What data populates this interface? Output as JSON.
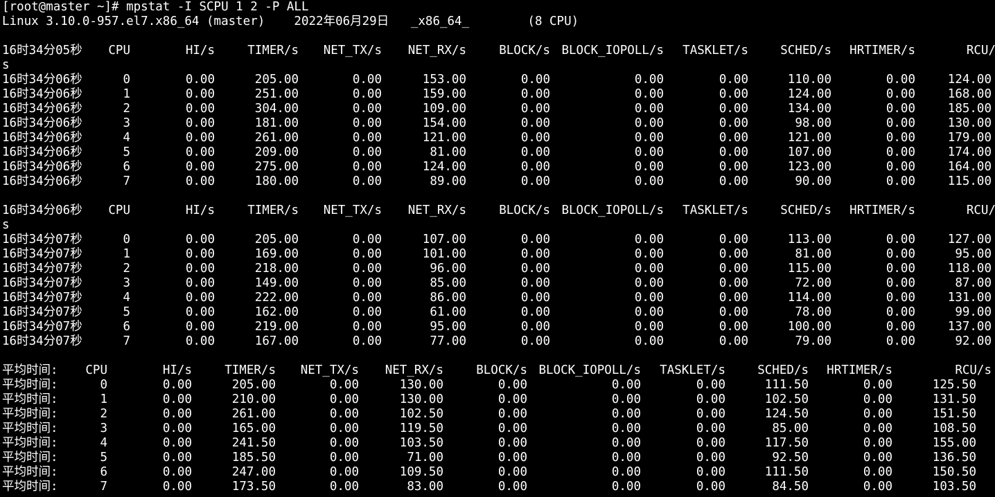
{
  "terminal": {
    "prompt": "[root@master ~]# mpstat -I SCPU 1 2 -P ALL",
    "sysinfo": "Linux 3.10.0-957.el7.x86_64 (master)    2022年06月29日   _x86_64_        (8 CPU)"
  },
  "headers": [
    "CPU",
    "HI/s",
    "TIMER/s",
    "NET_TX/s",
    "NET_RX/s",
    "BLOCK/s",
    "BLOCK_IOPOLL/s",
    "TASKLET/s",
    "SCHED/s",
    "HRTIMER/s",
    "RCU/s"
  ],
  "blocks": [
    {
      "time": "16时34分05秒",
      "rows": [
        {
          "time": "16时34分06秒",
          "cells": [
            "0",
            "0.00",
            "205.00",
            "0.00",
            "153.00",
            "0.00",
            "0.00",
            "0.00",
            "110.00",
            "0.00",
            "124.00"
          ]
        },
        {
          "time": "16时34分06秒",
          "cells": [
            "1",
            "0.00",
            "251.00",
            "0.00",
            "159.00",
            "0.00",
            "0.00",
            "0.00",
            "124.00",
            "0.00",
            "168.00"
          ]
        },
        {
          "time": "16时34分06秒",
          "cells": [
            "2",
            "0.00",
            "304.00",
            "0.00",
            "109.00",
            "0.00",
            "0.00",
            "0.00",
            "134.00",
            "0.00",
            "185.00"
          ]
        },
        {
          "time": "16时34分06秒",
          "cells": [
            "3",
            "0.00",
            "181.00",
            "0.00",
            "154.00",
            "0.00",
            "0.00",
            "0.00",
            "98.00",
            "0.00",
            "130.00"
          ]
        },
        {
          "time": "16时34分06秒",
          "cells": [
            "4",
            "0.00",
            "261.00",
            "0.00",
            "121.00",
            "0.00",
            "0.00",
            "0.00",
            "121.00",
            "0.00",
            "179.00"
          ]
        },
        {
          "time": "16时34分06秒",
          "cells": [
            "5",
            "0.00",
            "209.00",
            "0.00",
            "81.00",
            "0.00",
            "0.00",
            "0.00",
            "107.00",
            "0.00",
            "174.00"
          ]
        },
        {
          "time": "16时34分06秒",
          "cells": [
            "6",
            "0.00",
            "275.00",
            "0.00",
            "124.00",
            "0.00",
            "0.00",
            "0.00",
            "123.00",
            "0.00",
            "164.00"
          ]
        },
        {
          "time": "16时34分06秒",
          "cells": [
            "7",
            "0.00",
            "180.00",
            "0.00",
            "89.00",
            "0.00",
            "0.00",
            "0.00",
            "90.00",
            "0.00",
            "115.00"
          ]
        }
      ]
    },
    {
      "time": "16时34分06秒",
      "rows": [
        {
          "time": "16时34分07秒",
          "cells": [
            "0",
            "0.00",
            "205.00",
            "0.00",
            "107.00",
            "0.00",
            "0.00",
            "0.00",
            "113.00",
            "0.00",
            "127.00"
          ]
        },
        {
          "time": "16时34分07秒",
          "cells": [
            "1",
            "0.00",
            "169.00",
            "0.00",
            "101.00",
            "0.00",
            "0.00",
            "0.00",
            "81.00",
            "0.00",
            "95.00"
          ]
        },
        {
          "time": "16时34分07秒",
          "cells": [
            "2",
            "0.00",
            "218.00",
            "0.00",
            "96.00",
            "0.00",
            "0.00",
            "0.00",
            "115.00",
            "0.00",
            "118.00"
          ]
        },
        {
          "time": "16时34分07秒",
          "cells": [
            "3",
            "0.00",
            "149.00",
            "0.00",
            "85.00",
            "0.00",
            "0.00",
            "0.00",
            "72.00",
            "0.00",
            "87.00"
          ]
        },
        {
          "time": "16时34分07秒",
          "cells": [
            "4",
            "0.00",
            "222.00",
            "0.00",
            "86.00",
            "0.00",
            "0.00",
            "0.00",
            "114.00",
            "0.00",
            "131.00"
          ]
        },
        {
          "time": "16时34分07秒",
          "cells": [
            "5",
            "0.00",
            "162.00",
            "0.00",
            "61.00",
            "0.00",
            "0.00",
            "0.00",
            "78.00",
            "0.00",
            "99.00"
          ]
        },
        {
          "time": "16时34分07秒",
          "cells": [
            "6",
            "0.00",
            "219.00",
            "0.00",
            "95.00",
            "0.00",
            "0.00",
            "0.00",
            "100.00",
            "0.00",
            "137.00"
          ]
        },
        {
          "time": "16时34分07秒",
          "cells": [
            "7",
            "0.00",
            "167.00",
            "0.00",
            "77.00",
            "0.00",
            "0.00",
            "0.00",
            "79.00",
            "0.00",
            "92.00"
          ]
        }
      ]
    }
  ],
  "average": {
    "label": "平均时间:",
    "rows": [
      [
        "0",
        "0.00",
        "205.00",
        "0.00",
        "130.00",
        "0.00",
        "0.00",
        "0.00",
        "111.50",
        "0.00",
        "125.50"
      ],
      [
        "1",
        "0.00",
        "210.00",
        "0.00",
        "130.00",
        "0.00",
        "0.00",
        "0.00",
        "102.50",
        "0.00",
        "131.50"
      ],
      [
        "2",
        "0.00",
        "261.00",
        "0.00",
        "102.50",
        "0.00",
        "0.00",
        "0.00",
        "124.50",
        "0.00",
        "151.50"
      ],
      [
        "3",
        "0.00",
        "165.00",
        "0.00",
        "119.50",
        "0.00",
        "0.00",
        "0.00",
        "85.00",
        "0.00",
        "108.50"
      ],
      [
        "4",
        "0.00",
        "241.50",
        "0.00",
        "103.50",
        "0.00",
        "0.00",
        "0.00",
        "117.50",
        "0.00",
        "155.00"
      ],
      [
        "5",
        "0.00",
        "185.50",
        "0.00",
        "71.00",
        "0.00",
        "0.00",
        "0.00",
        "92.50",
        "0.00",
        "136.50"
      ],
      [
        "6",
        "0.00",
        "247.00",
        "0.00",
        "109.50",
        "0.00",
        "0.00",
        "0.00",
        "111.50",
        "0.00",
        "150.50"
      ],
      [
        "7",
        "0.00",
        "173.50",
        "0.00",
        "83.00",
        "0.00",
        "0.00",
        "0.00",
        "84.50",
        "0.00",
        "103.50"
      ]
    ]
  },
  "theme": {
    "background": "#000000",
    "foreground": "#ffffff"
  }
}
